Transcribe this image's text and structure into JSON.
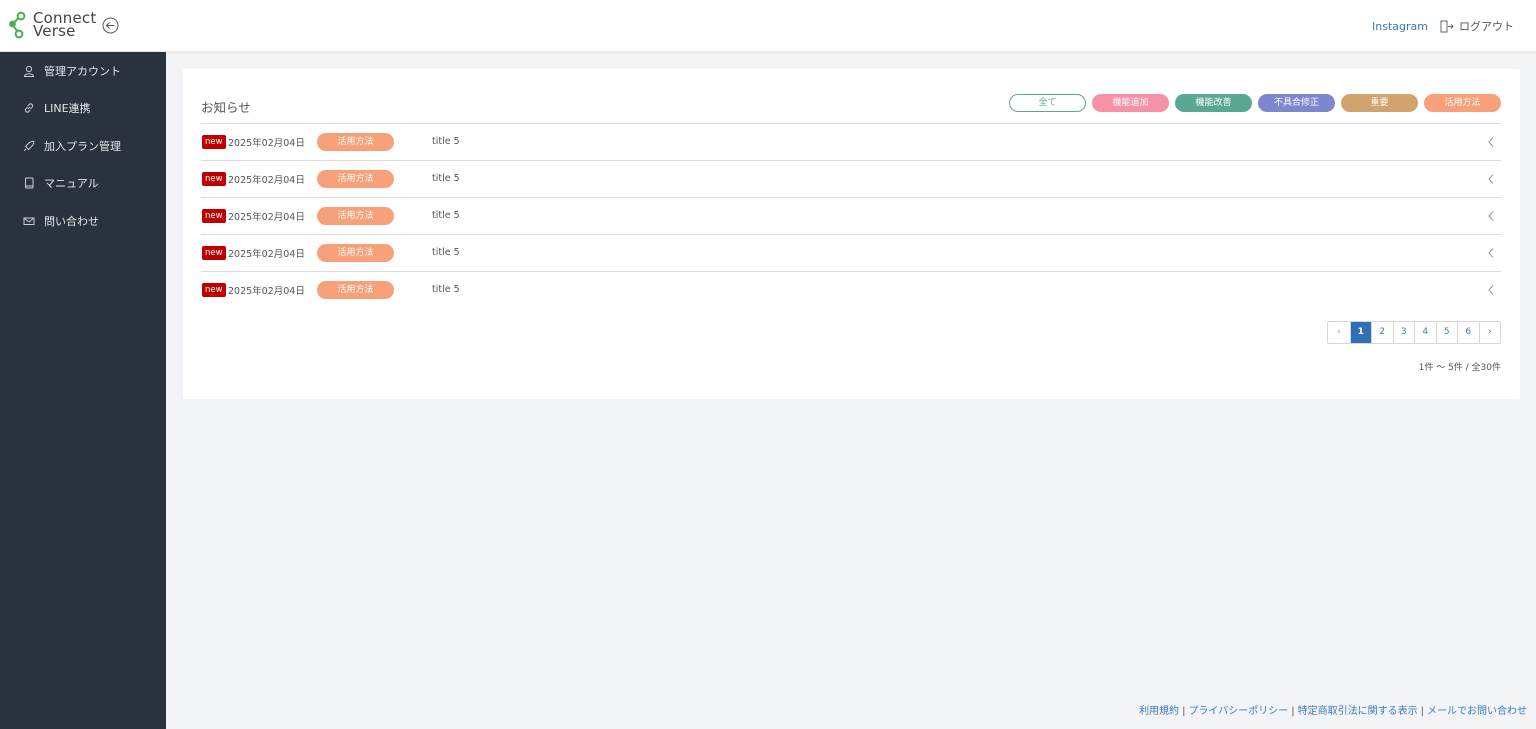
{
  "brand": {
    "line1": "Connect",
    "line2": "Verse",
    "logo_color": "#4caf50"
  },
  "header": {
    "instagram_label": "Instagram",
    "logout_label": "ログアウト"
  },
  "sidebar": {
    "items": [
      {
        "label": "管理アカウント",
        "icon": "user-icon"
      },
      {
        "label": "LINE連携",
        "icon": "link-icon"
      },
      {
        "label": "加入プラン管理",
        "icon": "rocket-icon"
      },
      {
        "label": "マニュアル",
        "icon": "book-icon"
      },
      {
        "label": "問い合わせ",
        "icon": "mail-icon"
      }
    ]
  },
  "notices": {
    "title": "お知らせ",
    "filters": [
      {
        "label": "全て",
        "color": "#5aa894"
      },
      {
        "label": "機能追加",
        "color": "#f592a6"
      },
      {
        "label": "機能改善",
        "color": "#5aa894"
      },
      {
        "label": "不具合修正",
        "color": "#7e86cd"
      },
      {
        "label": "重要",
        "color": "#d0a46c"
      },
      {
        "label": "活用方法",
        "color": "#f7a17a"
      }
    ],
    "rows": [
      {
        "badge": "new",
        "date": "2025年02月04日",
        "tag": "活用方法",
        "title": "title 5"
      },
      {
        "badge": "new",
        "date": "2025年02月04日",
        "tag": "活用方法",
        "title": "title 5"
      },
      {
        "badge": "new",
        "date": "2025年02月04日",
        "tag": "活用方法",
        "title": "title 5"
      },
      {
        "badge": "new",
        "date": "2025年02月04日",
        "tag": "活用方法",
        "title": "title 5"
      },
      {
        "badge": "new",
        "date": "2025年02月04日",
        "tag": "活用方法",
        "title": "title 5"
      }
    ],
    "pagination": {
      "prev": "‹",
      "pages": [
        "1",
        "2",
        "3",
        "4",
        "5",
        "6"
      ],
      "next": "›",
      "current": "1"
    },
    "count_text": "1件 〜 5件 / 全30件"
  },
  "footer": {
    "links": [
      "利用規約",
      "プライバシーポリシー",
      "特定商取引法に関する表示",
      "メールでお問い合わせ"
    ],
    "separator": "|"
  }
}
